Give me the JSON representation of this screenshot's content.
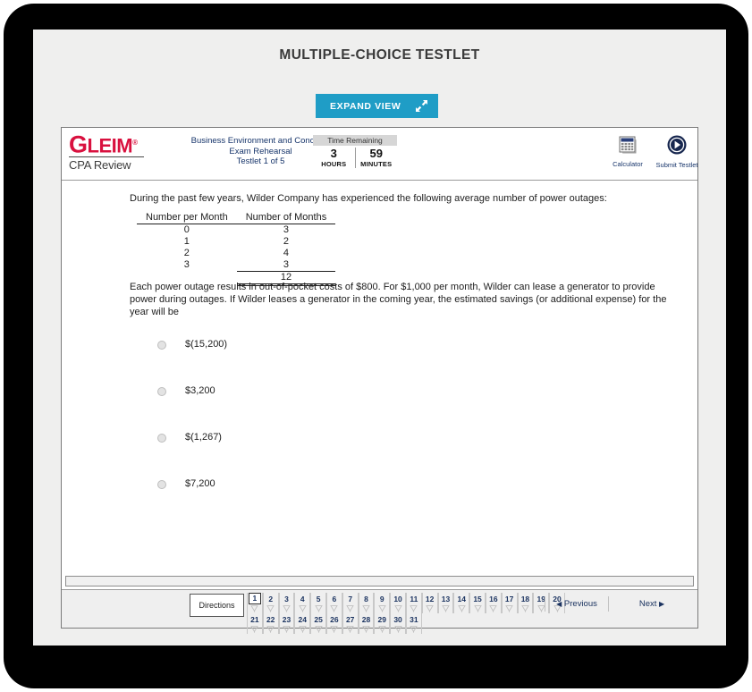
{
  "page": {
    "title": "MULTIPLE-CHOICE TESTLET",
    "expand_view_label": "EXPAND VIEW",
    "expand_icon": "diagonal-expand-arrows-icon"
  },
  "exam": {
    "brand": {
      "wordmark_lead": "G",
      "wordmark_rest": "LEIM",
      "registered_mark": "®",
      "subtitle": "CPA Review"
    },
    "header": {
      "section_title": "Business Environment and Concepts",
      "exam_mode": "Exam Rehearsal",
      "testlet_progress": "Testlet 1 of 5",
      "timer_label": "Time Remaining",
      "timer": [
        {
          "value": "3",
          "unit": "HOURS"
        },
        {
          "value": "59",
          "unit": "MINUTES"
        }
      ],
      "tools": [
        {
          "name": "calculator",
          "label": "Calculator",
          "icon": "calculator-icon"
        },
        {
          "name": "submit-testlet",
          "label": "Submit Testlet",
          "icon": "arrow-circle-right-icon"
        }
      ]
    },
    "question": {
      "stem": "During the past few years, Wilder Company has experienced the following average number of power outages:",
      "table": {
        "headers": [
          "Number per Month",
          "Number of Months"
        ],
        "rows": [
          [
            "0",
            "3"
          ],
          [
            "1",
            "2"
          ],
          [
            "2",
            "4"
          ],
          [
            "3",
            "3"
          ]
        ],
        "total": "12"
      },
      "prompt": "Each power outage results in out-of-pocket costs of $800. For $1,000 per month, Wilder can lease a generator to provide power during outages. If Wilder leases a generator in the coming year, the estimated savings (or additional expense) for the year will be",
      "choices": [
        {
          "label": "$(15,200)",
          "selected": false
        },
        {
          "label": "$3,200",
          "selected": false
        },
        {
          "label": "$(1,267)",
          "selected": false
        },
        {
          "label": "$7,200",
          "selected": false
        }
      ]
    },
    "footer": {
      "directions_label": "Directions",
      "question_numbers_row1": [
        "1",
        "2",
        "3",
        "4",
        "5",
        "6",
        "7",
        "8",
        "9",
        "10",
        "11",
        "12",
        "13",
        "14",
        "15",
        "16",
        "17",
        "18",
        "19",
        "20"
      ],
      "question_numbers_row2": [
        "21",
        "22",
        "23",
        "24",
        "25",
        "26",
        "27",
        "28",
        "29",
        "30",
        "31"
      ],
      "current_question": "1",
      "previous_label": "Previous",
      "next_label": "Next",
      "previous_icon": "triangle-left-icon",
      "next_icon": "triangle-right-icon",
      "flag_icon": "flag-outline-icon"
    }
  },
  "colors": {
    "accent_button": "#1f9dc6",
    "brand_red": "#d9113f",
    "nav_text_blue": "#1b3360",
    "page_background": "#efefee"
  }
}
